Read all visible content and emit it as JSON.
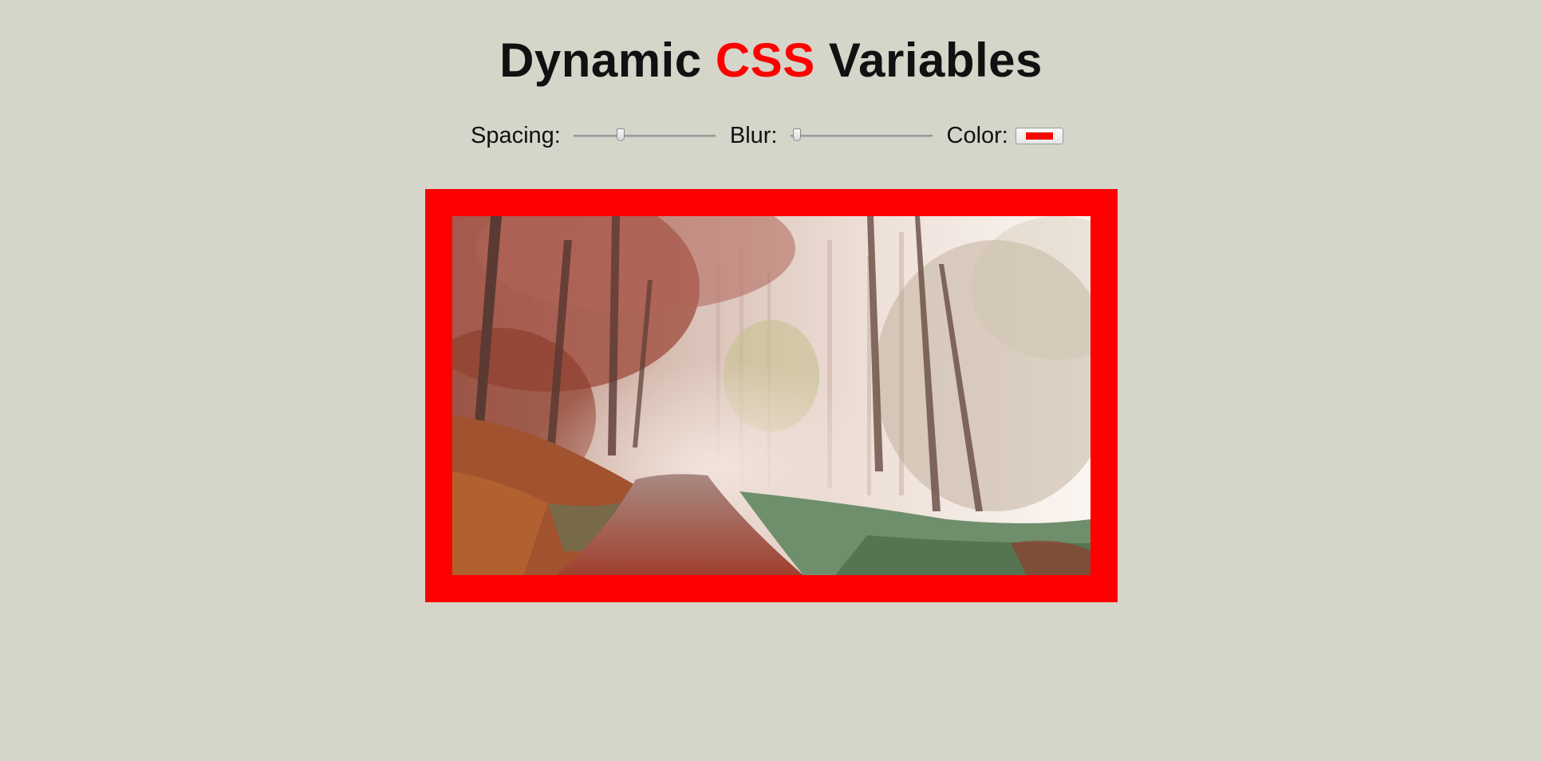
{
  "header": {
    "title_pre": "Dynamic ",
    "title_highlight": "CSS",
    "title_post": " Variables"
  },
  "controls": {
    "spacing_label": "Spacing:",
    "spacing_level": 0.33,
    "blur_label": "Blur:",
    "blur_level": 0.05,
    "color_label": "Color:",
    "color_value": "#ff0000"
  },
  "colors": {
    "accent": "#ff0000",
    "background": "#d5d5ca"
  },
  "image": {
    "subject": "misty autumn forest path"
  }
}
